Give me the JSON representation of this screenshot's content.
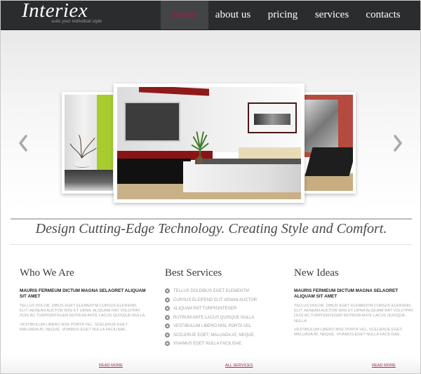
{
  "header": {
    "logo": "Interiex",
    "slogan": "suits your individual style",
    "nav": [
      {
        "label": "home",
        "active": true
      },
      {
        "label": "about us",
        "active": false
      },
      {
        "label": "pricing",
        "active": false
      },
      {
        "label": "services",
        "active": false
      },
      {
        "label": "contacts",
        "active": false
      }
    ],
    "active_color": "#9c1e4a"
  },
  "slider": {
    "prev_icon": "chevron-left-icon",
    "next_icon": "chevron-right-icon",
    "slides": [
      {
        "name": "interior-slide-vase-green-wall"
      },
      {
        "name": "interior-slide-bedroom"
      },
      {
        "name": "interior-slide-chair-red-wall"
      }
    ]
  },
  "tagline": "Design Cutting-Edge Technology. Creating Style and Comfort.",
  "columns": [
    {
      "title": "Who We Are",
      "lead": "MAURIS FERMEUM DICTUM MAGNA SELAORET ALIQUAM SIT AMET",
      "paragraphs": [
        "TELLUS DOLOR, DIBUS EGET ELEMENTM CURSUS ELEIFEND. ELIT. AENEAN AUCTOR WISI ET URNA. ALIQUAM RAT VOLUTPAT DUIS AC TURPISINTEGER RUTRUM ANTE LACUS QUISQUE NULLA.",
        "VESTIBULUM LIBERO NISL PORTA VEL, SCELERIJE EGET, MALUADA AT, NEQUE. VIVAMUS EGET NULLA FACILISAE."
      ],
      "link": "READ MORE"
    },
    {
      "title": "Best Services",
      "items": [
        "TELLUS DOLDIBUS EGET ELEMENTM",
        "CURSUS ELEIFEND ELIT AENAN AUCTOR",
        "ALIQUAM RAT TURPISINTEGER",
        "RUTRUM ANTE LACUS QUISQUE NULLA",
        "VESTIBULUM LIBERO NISL PORTA VEL",
        "SCELERIJE EGET, MALUADA AT, NEQUE.",
        "VIVAMUS EGET NULLA FACILISAE."
      ],
      "link": "ALL SERVICES"
    },
    {
      "title": "New Ideas",
      "lead": "MAURIS FERMEUM DICTUM MAGNA SELAORET ALIQUAM SIT AMET",
      "paragraphs": [
        "TELLUS DOLOR, DIBUS EGET ELEMENTM CURSUS ELEIFEND, ELIT. AENEAN AUCTOR WISI ET URNA ALIQUAM RAT VOLUTPAT DUIS AC TURPISINTEGER RUTRUM ANTE LACUS QUISQUE NULLA.",
        "VESTIBULUM LIBERO NISL PORTA VEL, SCELERIJE EGET, MALUADA AT, NEQUE. VIVAMUS EGET NULLA FACILISAE."
      ],
      "link": "READ MORE"
    }
  ],
  "colors": {
    "header_bg": "#2b2c2e",
    "link": "#a0285a"
  }
}
